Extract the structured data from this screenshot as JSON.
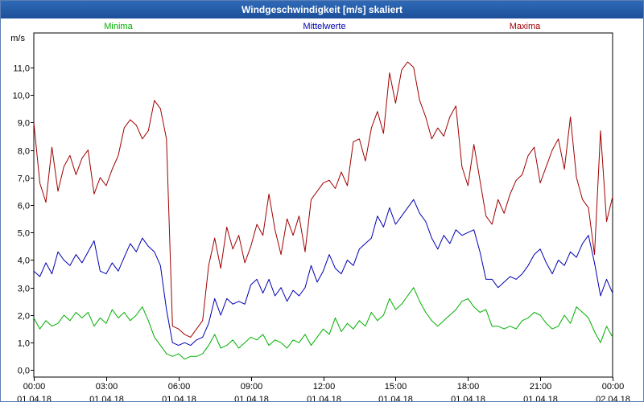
{
  "window": {
    "title": "Windgeschwindigkeit [m/s] skaliert"
  },
  "chart_data": {
    "type": "line",
    "title": "Windgeschwindigkeit [m/s] skaliert",
    "ylabel": "m/s",
    "ylim": [
      -0.25,
      12.25
    ],
    "y_ticks": [
      "0,0",
      "1,0",
      "2,0",
      "3,0",
      "4,0",
      "5,0",
      "6,0",
      "7,0",
      "8,0",
      "9,0",
      "10,0",
      "11,0"
    ],
    "x_ticks": [
      {
        "time": "00:00",
        "date": "01.04.18"
      },
      {
        "time": "03:00",
        "date": "01.04.18"
      },
      {
        "time": "06:00",
        "date": "01.04.18"
      },
      {
        "time": "09:00",
        "date": "01.04.18"
      },
      {
        "time": "12:00",
        "date": "01.04.18"
      },
      {
        "time": "15:00",
        "date": "01.04.18"
      },
      {
        "time": "18:00",
        "date": "01.04.18"
      },
      {
        "time": "21:00",
        "date": "01.04.18"
      },
      {
        "time": "00:00",
        "date": "02.04.18"
      }
    ],
    "grid": true,
    "x_hours": [
      0,
      0.25,
      0.5,
      0.75,
      1,
      1.25,
      1.5,
      1.75,
      2,
      2.25,
      2.5,
      2.75,
      3,
      3.25,
      3.5,
      3.75,
      4,
      4.25,
      4.5,
      4.75,
      5,
      5.25,
      5.5,
      5.75,
      6,
      6.25,
      6.5,
      6.75,
      7,
      7.25,
      7.5,
      7.75,
      8,
      8.25,
      8.5,
      8.75,
      9,
      9.25,
      9.5,
      9.75,
      10,
      10.25,
      10.5,
      10.75,
      11,
      11.25,
      11.5,
      11.75,
      12,
      12.25,
      12.5,
      12.75,
      13,
      13.25,
      13.5,
      13.75,
      14,
      14.25,
      14.5,
      14.75,
      15,
      15.25,
      15.5,
      15.75,
      16,
      16.25,
      16.5,
      16.75,
      17,
      17.25,
      17.5,
      17.75,
      18,
      18.25,
      18.5,
      18.75,
      19,
      19.25,
      19.5,
      19.75,
      20,
      20.25,
      20.5,
      20.75,
      21,
      21.25,
      21.5,
      21.75,
      22,
      22.25,
      22.5,
      22.75,
      23,
      23.25,
      23.5,
      23.75,
      24
    ],
    "series": [
      {
        "name": "Minima",
        "color": "#00b000",
        "values": [
          1.9,
          1.5,
          1.8,
          1.6,
          1.7,
          2.0,
          1.8,
          2.1,
          1.9,
          2.1,
          1.6,
          1.9,
          1.7,
          2.2,
          1.9,
          2.1,
          1.8,
          2.0,
          2.3,
          1.8,
          1.2,
          0.9,
          0.6,
          0.5,
          0.6,
          0.4,
          0.5,
          0.5,
          0.6,
          0.9,
          1.3,
          0.8,
          0.9,
          1.1,
          0.8,
          1.0,
          1.2,
          1.1,
          1.3,
          0.9,
          1.1,
          1.0,
          0.8,
          1.1,
          1.0,
          1.3,
          0.9,
          1.2,
          1.5,
          1.3,
          1.9,
          1.4,
          1.7,
          1.5,
          1.8,
          1.6,
          2.1,
          1.8,
          2.0,
          2.6,
          2.2,
          2.4,
          2.7,
          3.0,
          2.5,
          2.1,
          1.8,
          1.6,
          1.8,
          2.0,
          2.2,
          2.5,
          2.6,
          2.3,
          2.1,
          2.2,
          1.6,
          1.6,
          1.5,
          1.6,
          1.5,
          1.8,
          1.9,
          2.1,
          2.0,
          1.7,
          1.5,
          1.6,
          2.0,
          1.7,
          2.3,
          2.1,
          1.9,
          1.4,
          1.0,
          1.6,
          1.2
        ]
      },
      {
        "name": "Mittelwerte",
        "color": "#0000b0",
        "values": [
          3.6,
          3.4,
          3.9,
          3.5,
          4.3,
          4.0,
          3.8,
          4.2,
          3.9,
          4.3,
          4.7,
          3.6,
          3.5,
          3.9,
          3.6,
          4.1,
          4.6,
          4.3,
          4.8,
          4.5,
          4.3,
          3.8,
          2.2,
          1.0,
          0.9,
          1.0,
          0.9,
          1.1,
          1.2,
          1.7,
          2.6,
          2.0,
          2.6,
          2.4,
          2.5,
          2.4,
          3.1,
          3.3,
          2.8,
          3.3,
          2.7,
          3.0,
          2.5,
          2.9,
          2.7,
          3.0,
          3.8,
          3.2,
          3.6,
          4.2,
          3.7,
          3.5,
          4.0,
          3.8,
          4.4,
          4.6,
          4.8,
          5.6,
          5.2,
          5.9,
          5.3,
          5.6,
          5.9,
          6.2,
          5.7,
          5.4,
          4.8,
          4.4,
          4.9,
          4.6,
          5.1,
          4.9,
          5.0,
          5.1,
          4.3,
          3.3,
          3.3,
          3.0,
          3.2,
          3.4,
          3.3,
          3.5,
          3.8,
          4.2,
          4.4,
          3.9,
          3.5,
          4.0,
          3.8,
          4.3,
          4.1,
          4.6,
          4.9,
          3.9,
          2.7,
          3.3,
          2.8
        ]
      },
      {
        "name": "Maxima",
        "color": "#a00000",
        "values": [
          9.0,
          6.8,
          6.1,
          8.1,
          6.5,
          7.4,
          7.8,
          7.1,
          7.7,
          8.0,
          6.4,
          7.0,
          6.7,
          7.3,
          7.8,
          8.8,
          9.1,
          8.9,
          8.4,
          8.7,
          9.8,
          9.5,
          8.4,
          1.6,
          1.5,
          1.3,
          1.2,
          1.5,
          1.8,
          3.8,
          4.8,
          3.7,
          5.2,
          4.4,
          4.9,
          3.9,
          4.5,
          5.3,
          4.9,
          6.4,
          5.1,
          4.2,
          5.5,
          4.9,
          5.6,
          4.3,
          6.2,
          6.5,
          6.8,
          6.9,
          6.6,
          7.2,
          6.7,
          8.3,
          8.4,
          7.6,
          8.8,
          9.4,
          8.6,
          10.8,
          9.7,
          10.9,
          11.2,
          11.0,
          9.8,
          9.2,
          8.4,
          8.8,
          8.5,
          9.2,
          9.6,
          7.4,
          6.7,
          8.2,
          6.9,
          5.6,
          5.3,
          6.2,
          5.7,
          6.4,
          6.9,
          7.1,
          7.8,
          8.1,
          6.8,
          7.4,
          8.0,
          8.4,
          7.3,
          9.2,
          7.0,
          6.2,
          5.9,
          4.2,
          8.7,
          5.4,
          6.3
        ]
      }
    ]
  }
}
